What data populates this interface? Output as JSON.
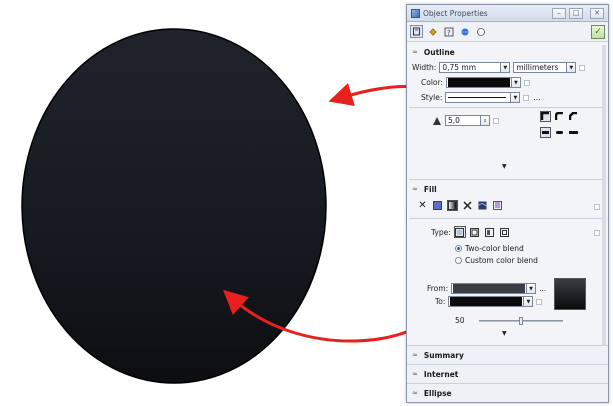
{
  "docker": {
    "title": "Object Properties",
    "title_buttons": [
      "minimize",
      "maximize",
      "close"
    ],
    "toolbar_icons": [
      "outline-pen-icon",
      "fill-bucket-icon",
      "text-icon",
      "internet-icon",
      "ellipse-icon"
    ]
  },
  "outline": {
    "header": "Outline",
    "width_label": "Width:",
    "width_value": "0,75 mm",
    "units_value": "millimeters",
    "color_label": "Color:",
    "color_value": "#0a0a0a",
    "style_label": "Style:",
    "style_more": "...",
    "miter_value": "5,0"
  },
  "fill": {
    "header": "Fill",
    "type_label": "Type:",
    "two_color_label": "Two-color blend",
    "custom_color_label": "Custom color blend",
    "from_label": "From:",
    "to_label": "To:",
    "from_color": "#3a3d45",
    "to_color": "#0a0a0a",
    "midpoint_value": "50",
    "midpoint_fraction": 0.5,
    "more": "..."
  },
  "sections": {
    "summary": "Summary",
    "internet": "Internet",
    "ellipse": "Ellipse"
  },
  "canvas": {
    "circle_fill_top": "#1a1d24",
    "circle_fill_bottom": "#0c0d10",
    "arrow_color": "#e8201e"
  }
}
